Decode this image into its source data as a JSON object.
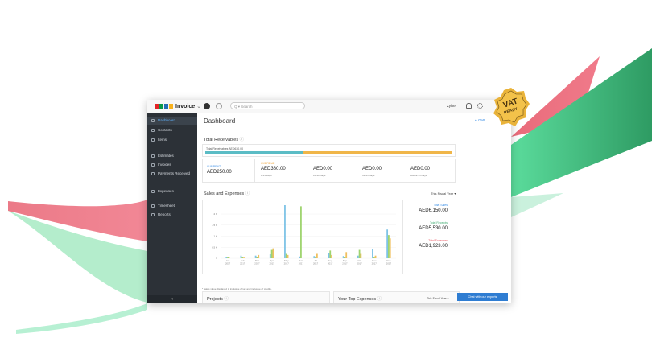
{
  "colors": {
    "sidebar": "#2c3137",
    "accent": "#3a8ee6",
    "teal": "#5bbcc5",
    "orange": "#f0b649",
    "green": "#3daa6f",
    "red": "#e8535f"
  },
  "topbar": {
    "app_name": "Invoice",
    "search_placeholder": "Q ▾ Search",
    "org": "Zylker"
  },
  "sidebar": {
    "items": [
      {
        "label": "Dashboard",
        "icon": "dashboard-icon",
        "active": true
      },
      {
        "label": "Contacts",
        "icon": "contacts-icon"
      },
      {
        "label": "Items",
        "icon": "items-icon"
      },
      {
        "label": "Estimates",
        "icon": "estimates-icon"
      },
      {
        "label": "Invoices",
        "icon": "invoices-icon"
      },
      {
        "label": "Payments Received",
        "icon": "payments-icon"
      },
      {
        "label": "Expenses",
        "icon": "expenses-icon"
      },
      {
        "label": "Timesheet",
        "icon": "timesheet-icon"
      },
      {
        "label": "Reports",
        "icon": "reports-icon"
      }
    ],
    "collapse": "‹"
  },
  "main": {
    "title": "Dashboard",
    "get_started": "Gett",
    "receivables": {
      "title": "Total Receivables",
      "subtitle": "Total Receivables AED630.00",
      "current": {
        "tag": "CURRENT",
        "amount": "AED250.00"
      },
      "overdue": {
        "tag": "OVERDUE",
        "amount": "AED380.00",
        "days": "1-15 Days"
      },
      "b2": {
        "amount": "AED0.00",
        "days": "16-30 Days"
      },
      "b3": {
        "amount": "AED0.00",
        "days": "31-45 Days"
      },
      "b4": {
        "amount": "AED0.00",
        "days": "Above 45 Days"
      }
    },
    "sales": {
      "title": "Sales and Expenses",
      "filter": "This Fiscal Year ▾",
      "footnote": "* Sales value displayed is inclusive of tax and inclusive of credits.",
      "totals": [
        {
          "label": "Total Sales",
          "value": "AED6,150.00"
        },
        {
          "label": "Total Receipts",
          "value": "AED5,530.00"
        },
        {
          "label": "Total Expenses",
          "value": "AED1,923.00"
        }
      ]
    },
    "projects": {
      "title": "Projects"
    },
    "top_expenses": {
      "title": "Your Top Expenses",
      "filter": "This Fiscal Year ▾"
    },
    "chat": "Chat with our experts"
  },
  "badge": {
    "line1": "VAT",
    "line2": "READY"
  },
  "chart_data": {
    "type": "bar",
    "categories": [
      "Jan 2017",
      "Feb 2017",
      "Mar 2017",
      "Apr 2017",
      "May 2017",
      "Jun 2017",
      "Jul 2017",
      "Aug 2017",
      "Sep 2017",
      "Oct 2017",
      "Nov 2017",
      "Dec 2017"
    ],
    "y_ticks": [
      "2 K",
      "1.5 K",
      "1 K",
      "0.5 K",
      "0"
    ],
    "ylim": [
      0,
      2400
    ],
    "series": [
      {
        "name": "Total Sales",
        "color": "#7ec3e6",
        "values": [
          60,
          120,
          120,
          180,
          2400,
          80,
          100,
          250,
          100,
          120,
          420,
          1300
        ]
      },
      {
        "name": "Total Receipts",
        "color": "#9fd46f",
        "values": [
          40,
          60,
          70,
          380,
          200,
          2350,
          70,
          350,
          70,
          380,
          60,
          1050
        ]
      },
      {
        "name": "Total Expenses",
        "color": "#f0c060",
        "values": [
          20,
          30,
          150,
          450,
          150,
          0,
          200,
          150,
          280,
          200,
          120,
          900
        ]
      }
    ]
  }
}
